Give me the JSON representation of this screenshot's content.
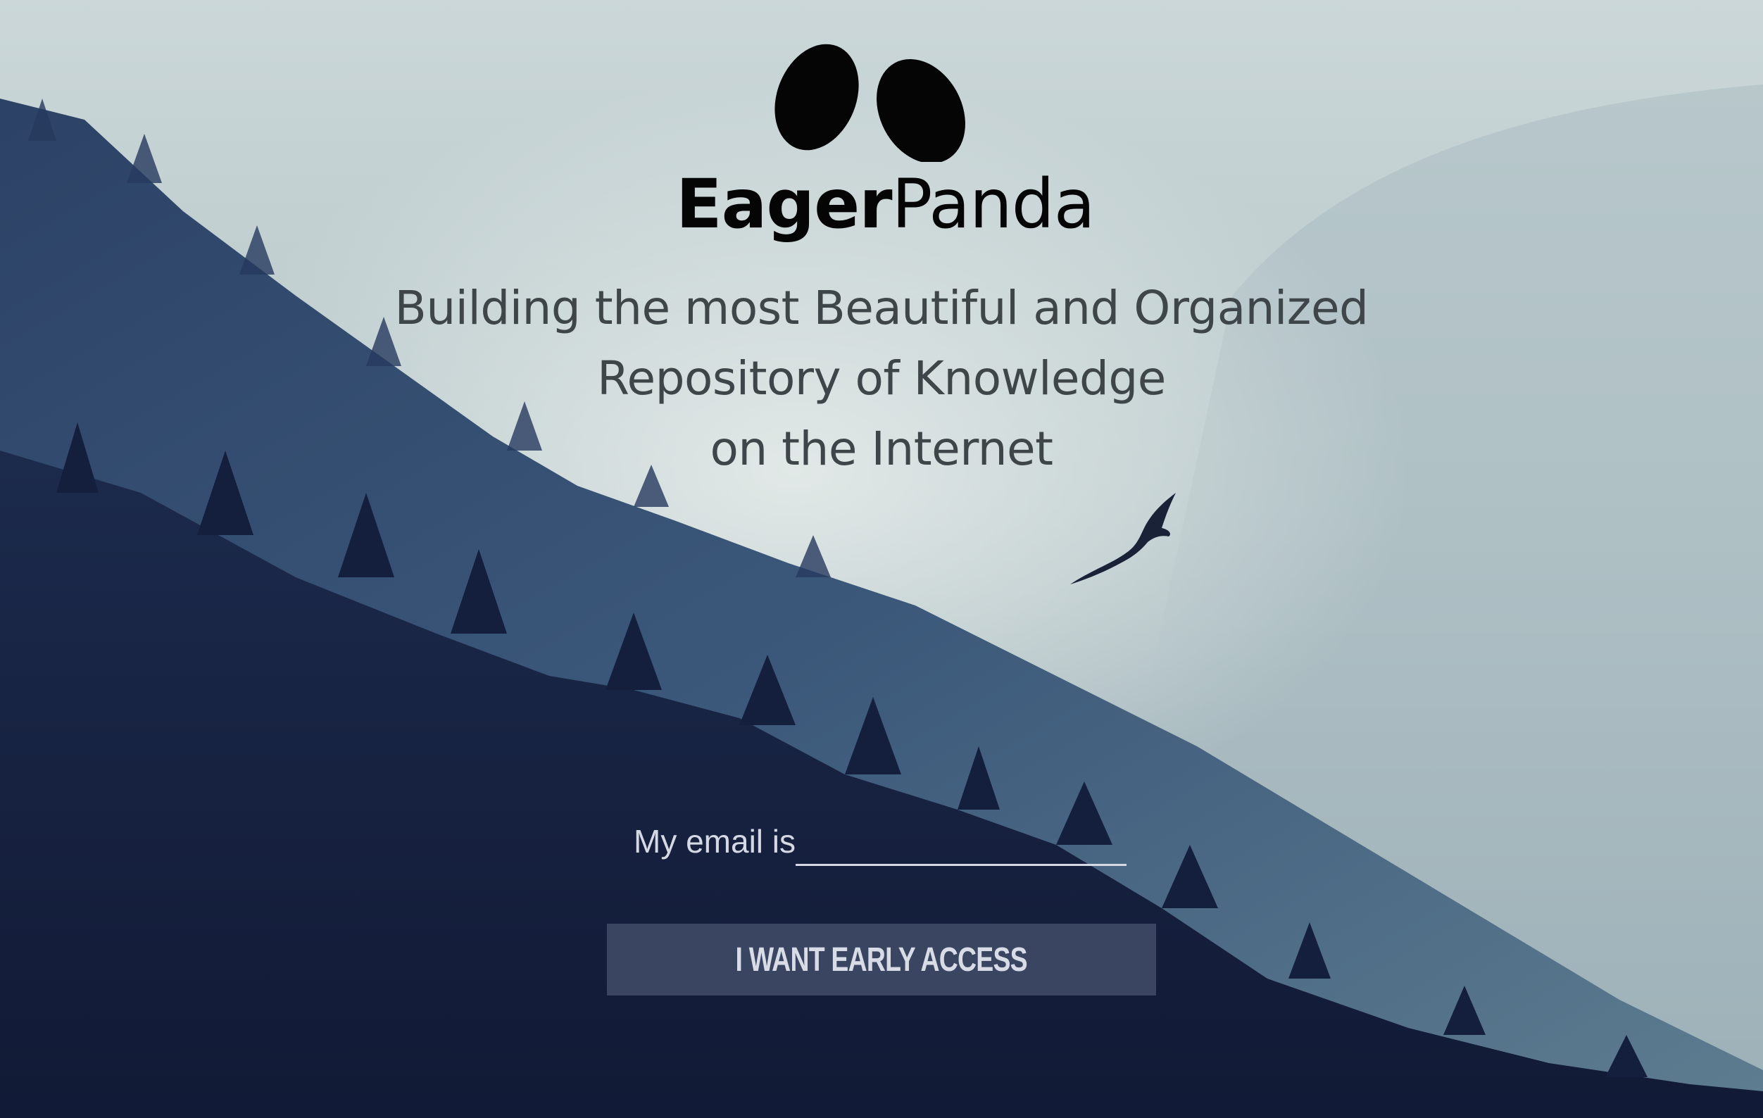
{
  "logo": {
    "wordmark_bold": "Eager",
    "wordmark_light": "Panda"
  },
  "tagline": {
    "line1": "Building the most Beautiful and Organized",
    "line2": "Repository of Knowledge",
    "line3": "on the Internet"
  },
  "signup": {
    "label": "My email is",
    "email_value": "",
    "button_label": "I WANT EARLY ACCESS"
  },
  "colors": {
    "button_bg": "#3a4562",
    "text_dark": "#3f4649",
    "logo": "#050505"
  }
}
